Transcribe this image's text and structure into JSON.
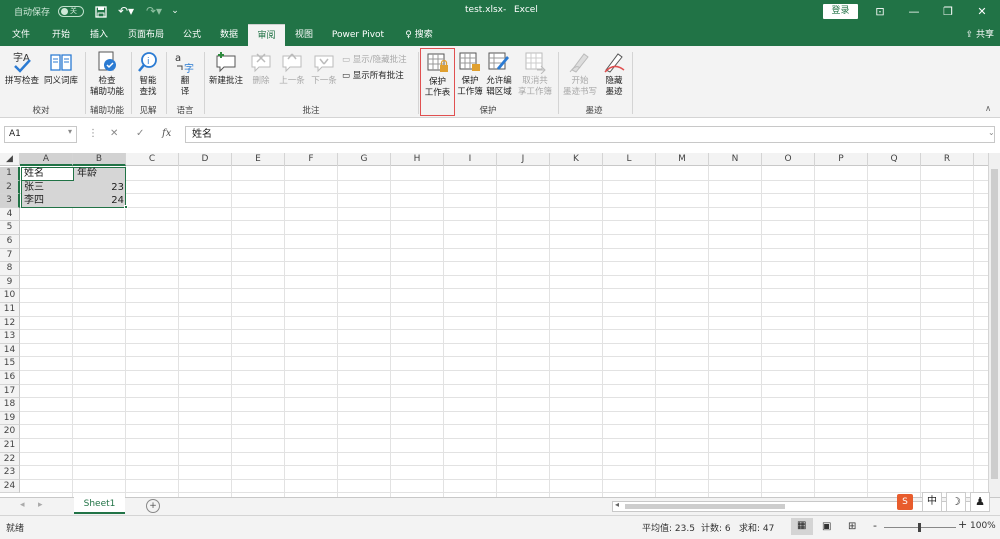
{
  "titlebar": {
    "autosave": "自动保存",
    "autosave_state": "关",
    "filename": "test.xlsx",
    "sep": "-",
    "app": "Excel",
    "login": "登录"
  },
  "tabs": [
    "文件",
    "开始",
    "插入",
    "页面布局",
    "公式",
    "数据",
    "审阅",
    "视图",
    "Power Pivot",
    "搜索"
  ],
  "share": "共享",
  "ribbon": {
    "proof": {
      "spell": "拼写检查",
      "thesaurus": "同义词库",
      "group": "校对"
    },
    "access": {
      "check1": "检查",
      "check2": "辅助功能",
      "group": "辅助功能"
    },
    "insights": {
      "smart1": "智能",
      "smart2": "查找",
      "group": "见解"
    },
    "lang": {
      "trans1": "翻",
      "trans2": "译",
      "group": "语言"
    },
    "comments": {
      "new": "新建批注",
      "delete": "删除",
      "prev": "上一条",
      "next": "下一条",
      "showhide": "显示/隐藏批注",
      "showall": "显示所有批注",
      "group": "批注"
    },
    "protect": {
      "sheet1": "保护",
      "sheet2": "工作表",
      "wb1": "保护",
      "wb2": "工作簿",
      "allow1": "允许编",
      "allow2": "辑区域",
      "unshare1": "取消共",
      "unshare2": "享工作簿",
      "group": "保护"
    },
    "ink": {
      "start1": "开始",
      "start2": "墨迹书写",
      "hide1": "隐藏",
      "hide2": "墨迹",
      "group": "墨迹"
    }
  },
  "formula": {
    "namebox": "A1",
    "content": "姓名",
    "fx": "fx"
  },
  "columns": [
    "A",
    "B",
    "C",
    "D",
    "E",
    "F",
    "G",
    "H",
    "I",
    "J",
    "K",
    "L",
    "M",
    "N",
    "O",
    "P",
    "Q",
    "R"
  ],
  "rows": [
    "1",
    "2",
    "3",
    "4",
    "5",
    "6",
    "7",
    "8",
    "9",
    "10",
    "11",
    "12",
    "13",
    "14",
    "15",
    "16",
    "17",
    "18",
    "19",
    "20",
    "21",
    "22",
    "23",
    "24"
  ],
  "cells": {
    "A1": "姓名",
    "B1": "年龄",
    "A2": "张三",
    "B2": "23",
    "A3": "李四",
    "B3": "24"
  },
  "sheet": {
    "name": "Sheet1",
    "add": "+"
  },
  "status": {
    "ready": "就绪",
    "avg": "平均值: 23.5",
    "count": "计数: 6",
    "sum": "求和: 47",
    "zoom": "100%",
    "minus": "-",
    "plus": "+"
  },
  "ime": {
    "zh": "中"
  },
  "colors": {
    "brand": "#217346",
    "ribbon": "#f3f3f3",
    "selection": "#d6d6d6",
    "highlight": "#e05050"
  }
}
